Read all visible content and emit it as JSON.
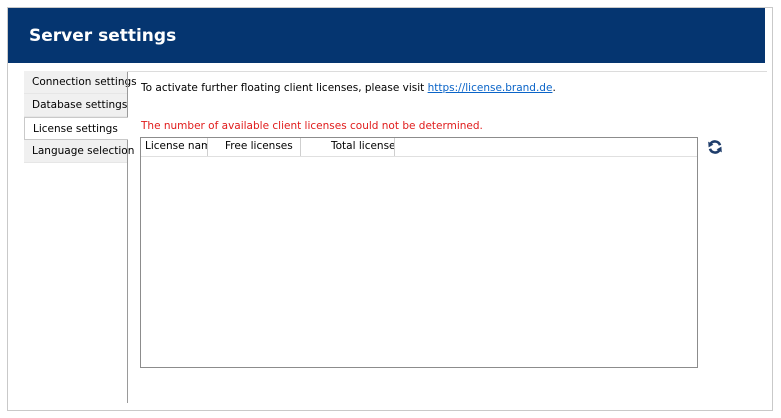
{
  "header": {
    "title": "Server settings"
  },
  "tabs": [
    {
      "label": "Connection settings",
      "active": false
    },
    {
      "label": "Database settings",
      "active": false
    },
    {
      "label": "License settings",
      "active": true
    },
    {
      "label": "Language selection",
      "active": false
    }
  ],
  "license": {
    "info_text": "To activate further floating client licenses, please visit ",
    "link_text": "https://license.brand.de",
    "info_suffix": ".",
    "error_text": "The number of available client licenses could not be determined.",
    "columns": [
      "License name",
      "Free licenses",
      "Total licenses"
    ],
    "rows": []
  },
  "icons": {
    "refresh": "refresh-icon"
  },
  "colors": {
    "header_bg": "#053570",
    "error": "#e01b1b",
    "link": "#0a64c8"
  }
}
